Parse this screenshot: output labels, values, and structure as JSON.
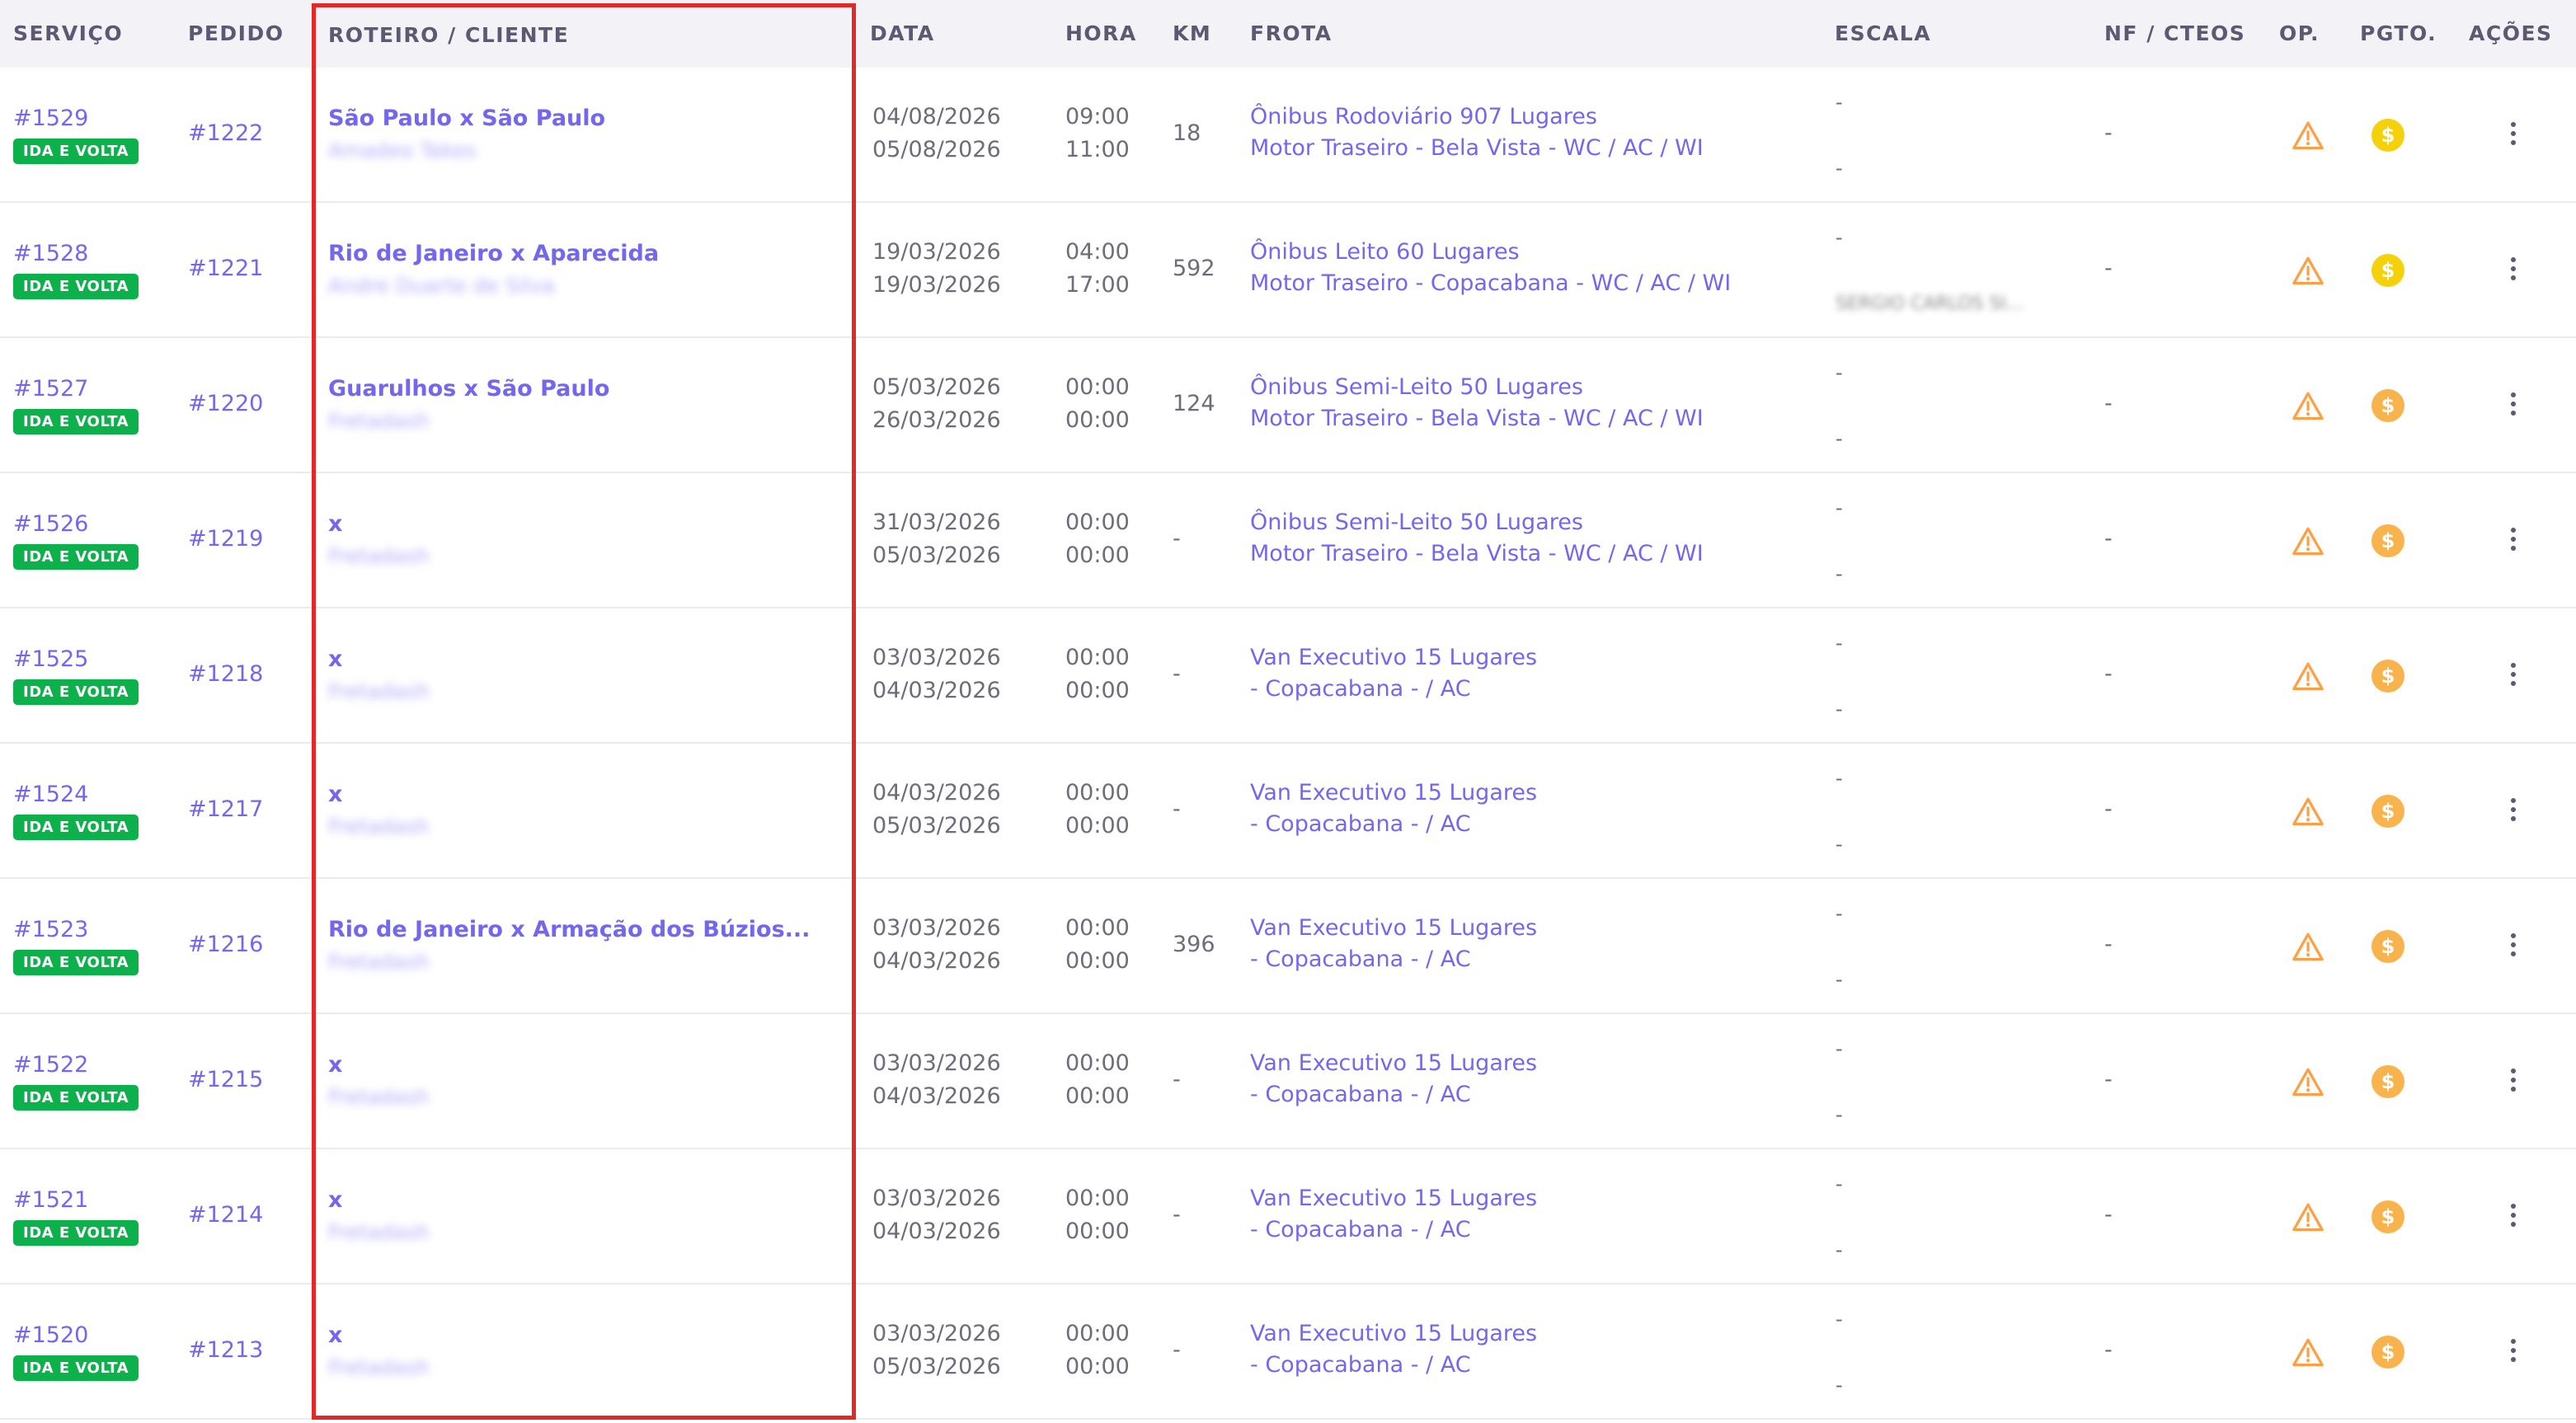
{
  "headers": {
    "servico": "SERVIÇO",
    "pedido": "PEDIDO",
    "roteiro": "ROTEIRO / CLIENTE",
    "data": "DATA",
    "hora": "HORA",
    "km": "KM",
    "frota": "FROTA",
    "escala": "ESCALA",
    "nf": "NF / CTEOS",
    "op": "OP.",
    "pgto": "PGTO.",
    "acoes": "AÇÕES"
  },
  "rows": [
    {
      "servico": "#1529",
      "badge": "IDA E VOLTA",
      "pedido": "#1222",
      "roteiro": "São Paulo x São Paulo",
      "cliente": "Amadeo Takes",
      "data1": "04/08/2026",
      "data2": "05/08/2026",
      "hora1": "09:00",
      "hora2": "11:00",
      "km": "18",
      "frota1": "Ônibus Rodoviário 907 Lugares",
      "frota2": "Motor Traseiro - Bela Vista - WC / AC / WI",
      "escala1": "-",
      "escala2": "-",
      "escala_blur": "",
      "nf": "-",
      "coin": "#f4d10b"
    },
    {
      "servico": "#1528",
      "badge": "IDA E VOLTA",
      "pedido": "#1221",
      "roteiro": "Rio de Janeiro x Aparecida",
      "cliente": "Andre Duarte de Silva",
      "data1": "19/03/2026",
      "data2": "19/03/2026",
      "hora1": "04:00",
      "hora2": "17:00",
      "km": "592",
      "frota1": "Ônibus Leito 60 Lugares",
      "frota2": "Motor Traseiro - Copacabana - WC / AC / WI",
      "escala1": "-",
      "escala2": "",
      "escala_blur": "SERGIO CARLOS SI...",
      "nf": "-",
      "coin": "#f4d10b"
    },
    {
      "servico": "#1527",
      "badge": "IDA E VOLTA",
      "pedido": "#1220",
      "roteiro": "Guarulhos x São Paulo",
      "cliente": "Fretadash",
      "data1": "05/03/2026",
      "data2": "26/03/2026",
      "hora1": "00:00",
      "hora2": "00:00",
      "km": "124",
      "frota1": "Ônibus Semi-Leito 50 Lugares",
      "frota2": "Motor Traseiro - Bela Vista - WC / AC / WI",
      "escala1": "-",
      "escala2": "-",
      "escala_blur": "",
      "nf": "-",
      "coin": "#f9b34d"
    },
    {
      "servico": "#1526",
      "badge": "IDA E VOLTA",
      "pedido": "#1219",
      "roteiro": "x",
      "cliente": "Fretadash",
      "data1": "31/03/2026",
      "data2": "05/03/2026",
      "hora1": "00:00",
      "hora2": "00:00",
      "km": "-",
      "frota1": "Ônibus Semi-Leito 50 Lugares",
      "frota2": "Motor Traseiro - Bela Vista - WC / AC / WI",
      "escala1": "-",
      "escala2": "-",
      "escala_blur": "",
      "nf": "-",
      "coin": "#f9b34d"
    },
    {
      "servico": "#1525",
      "badge": "IDA E VOLTA",
      "pedido": "#1218",
      "roteiro": "x",
      "cliente": "Fretadash",
      "data1": "03/03/2026",
      "data2": "04/03/2026",
      "hora1": "00:00",
      "hora2": "00:00",
      "km": "-",
      "frota1": "Van Executivo 15 Lugares",
      "frota2": "- Copacabana - / AC",
      "escala1": "-",
      "escala2": "-",
      "escala_blur": "",
      "nf": "-",
      "coin": "#f9b34d"
    },
    {
      "servico": "#1524",
      "badge": "IDA E VOLTA",
      "pedido": "#1217",
      "roteiro": "x",
      "cliente": "Fretadash",
      "data1": "04/03/2026",
      "data2": "05/03/2026",
      "hora1": "00:00",
      "hora2": "00:00",
      "km": "-",
      "frota1": "Van Executivo 15 Lugares",
      "frota2": "- Copacabana - / AC",
      "escala1": "-",
      "escala2": "-",
      "escala_blur": "",
      "nf": "-",
      "coin": "#f9b34d"
    },
    {
      "servico": "#1523",
      "badge": "IDA E VOLTA",
      "pedido": "#1216",
      "roteiro": "Rio de Janeiro x Armação dos Búzios...",
      "cliente": "Fretadash",
      "data1": "03/03/2026",
      "data2": "04/03/2026",
      "hora1": "00:00",
      "hora2": "00:00",
      "km": "396",
      "frota1": "Van Executivo 15 Lugares",
      "frota2": "- Copacabana - / AC",
      "escala1": "-",
      "escala2": "-",
      "escala_blur": "",
      "nf": "-",
      "coin": "#f9b34d"
    },
    {
      "servico": "#1522",
      "badge": "IDA E VOLTA",
      "pedido": "#1215",
      "roteiro": "x",
      "cliente": "Fretadash",
      "data1": "03/03/2026",
      "data2": "04/03/2026",
      "hora1": "00:00",
      "hora2": "00:00",
      "km": "-",
      "frota1": "Van Executivo 15 Lugares",
      "frota2": "- Copacabana - / AC",
      "escala1": "-",
      "escala2": "-",
      "escala_blur": "",
      "nf": "-",
      "coin": "#f9b34d"
    },
    {
      "servico": "#1521",
      "badge": "IDA E VOLTA",
      "pedido": "#1214",
      "roteiro": "x",
      "cliente": "Fretadash",
      "data1": "03/03/2026",
      "data2": "04/03/2026",
      "hora1": "00:00",
      "hora2": "00:00",
      "km": "-",
      "frota1": "Van Executivo 15 Lugares",
      "frota2": "- Copacabana - / AC",
      "escala1": "-",
      "escala2": "-",
      "escala_blur": "",
      "nf": "-",
      "coin": "#f9b34d"
    },
    {
      "servico": "#1520",
      "badge": "IDA E VOLTA",
      "pedido": "#1213",
      "roteiro": "x",
      "cliente": "Fretadash",
      "data1": "03/03/2026",
      "data2": "05/03/2026",
      "hora1": "00:00",
      "hora2": "00:00",
      "km": "-",
      "frota1": "Van Executivo 15 Lugares",
      "frota2": "- Copacabana - / AC",
      "escala1": "-",
      "escala2": "-",
      "escala_blur": "",
      "nf": "-",
      "coin": "#f9b34d"
    }
  ]
}
